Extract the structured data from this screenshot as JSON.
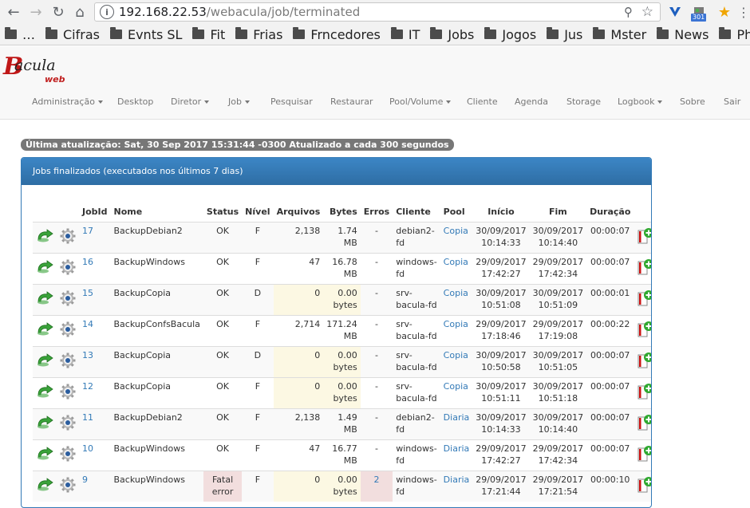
{
  "browser": {
    "url_host": "192.168.22.53",
    "url_path": "/webacula/job/terminated",
    "ext_badge": "301",
    "bookmarks": [
      "…",
      "Cifras",
      "Evnts SL",
      "Fit",
      "Frias",
      "Frncedores",
      "IT",
      "Jobs",
      "Jogos",
      "Jus",
      "Mster",
      "News",
      "PhD"
    ]
  },
  "app": {
    "logo_b": "B",
    "logo_text": "acula",
    "logo_sub": "web",
    "menu": [
      {
        "label": "Administração",
        "caret": true
      },
      {
        "label": "Desktop",
        "caret": false
      },
      {
        "label": "Diretor",
        "caret": true
      },
      {
        "label": "Job",
        "caret": true
      },
      {
        "label": "Pesquisar",
        "caret": false
      },
      {
        "label": "Restaurar",
        "caret": false
      },
      {
        "label": "Pool/Volume",
        "caret": true
      },
      {
        "label": "Cliente",
        "caret": false
      },
      {
        "label": "Agenda",
        "caret": false
      },
      {
        "label": "Storage",
        "caret": false
      },
      {
        "label": "Logbook",
        "caret": true
      },
      {
        "label": "Sobre",
        "caret": false
      },
      {
        "label": "Sair",
        "caret": false
      }
    ],
    "status_text": "Última atualização: Sat, 30 Sep 2017 15:31:44 -0300 Atualizado a cada 300 segundos",
    "panel_title": "Jobs finalizados (executados nos últimos 7 dias)"
  },
  "table": {
    "headers": [
      "",
      "",
      "JobId",
      "Nome",
      "Status",
      "Nível",
      "Arquivos",
      "Bytes",
      "Erros",
      "Cliente",
      "Pool",
      "Início",
      "Fim",
      "Duração",
      ""
    ],
    "rows": [
      {
        "jobid": "17",
        "nome": "BackupDebian2",
        "status": "OK",
        "nivel": "F",
        "arquivos": "2,138",
        "bytes": "1.74 MB",
        "erros": "-",
        "cliente": "debian2-fd",
        "pool": "Copia",
        "inicio": "30/09/2017 10:14:33",
        "fim": "30/09/2017 10:14:40",
        "duracao": "00:00:07",
        "warn": false,
        "err": false
      },
      {
        "jobid": "16",
        "nome": "BackupWindows",
        "status": "OK",
        "nivel": "F",
        "arquivos": "47",
        "bytes": "16.78 MB",
        "erros": "-",
        "cliente": "windows-fd",
        "pool": "Copia",
        "inicio": "29/09/2017 17:42:27",
        "fim": "29/09/2017 17:42:34",
        "duracao": "00:00:07",
        "warn": false,
        "err": false
      },
      {
        "jobid": "15",
        "nome": "BackupCopia",
        "status": "OK",
        "nivel": "D",
        "arquivos": "0",
        "bytes": "0.00 bytes",
        "erros": "-",
        "cliente": "srv-bacula-fd",
        "pool": "Copia",
        "inicio": "30/09/2017 10:51:08",
        "fim": "30/09/2017 10:51:09",
        "duracao": "00:00:01",
        "warn": true,
        "err": false
      },
      {
        "jobid": "14",
        "nome": "BackupConfsBacula",
        "status": "OK",
        "nivel": "F",
        "arquivos": "2,714",
        "bytes": "171.24 MB",
        "erros": "-",
        "cliente": "srv-bacula-fd",
        "pool": "Copia",
        "inicio": "29/09/2017 17:18:46",
        "fim": "29/09/2017 17:19:08",
        "duracao": "00:00:22",
        "warn": false,
        "err": false
      },
      {
        "jobid": "13",
        "nome": "BackupCopia",
        "status": "OK",
        "nivel": "D",
        "arquivos": "0",
        "bytes": "0.00 bytes",
        "erros": "-",
        "cliente": "srv-bacula-fd",
        "pool": "Copia",
        "inicio": "30/09/2017 10:50:58",
        "fim": "30/09/2017 10:51:05",
        "duracao": "00:00:07",
        "warn": true,
        "err": false
      },
      {
        "jobid": "12",
        "nome": "BackupCopia",
        "status": "OK",
        "nivel": "F",
        "arquivos": "0",
        "bytes": "0.00 bytes",
        "erros": "-",
        "cliente": "srv-bacula-fd",
        "pool": "Copia",
        "inicio": "30/09/2017 10:51:11",
        "fim": "30/09/2017 10:51:18",
        "duracao": "00:00:07",
        "warn": true,
        "err": false
      },
      {
        "jobid": "11",
        "nome": "BackupDebian2",
        "status": "OK",
        "nivel": "F",
        "arquivos": "2,138",
        "bytes": "1.49 MB",
        "erros": "-",
        "cliente": "debian2-fd",
        "pool": "Diaria",
        "inicio": "30/09/2017 10:14:33",
        "fim": "30/09/2017 10:14:40",
        "duracao": "00:00:07",
        "warn": false,
        "err": false
      },
      {
        "jobid": "10",
        "nome": "BackupWindows",
        "status": "OK",
        "nivel": "F",
        "arquivos": "47",
        "bytes": "16.77 MB",
        "erros": "-",
        "cliente": "windows-fd",
        "pool": "Diaria",
        "inicio": "29/09/2017 17:42:27",
        "fim": "29/09/2017 17:42:34",
        "duracao": "00:00:07",
        "warn": false,
        "err": false
      },
      {
        "jobid": "9",
        "nome": "BackupWindows",
        "status": "Fatal error",
        "nivel": "F",
        "arquivos": "0",
        "bytes": "0.00 bytes",
        "erros": "2",
        "cliente": "windows-fd",
        "pool": "Diaria",
        "inicio": "29/09/2017 17:21:44",
        "fim": "29/09/2017 17:21:54",
        "duracao": "00:00:10",
        "warn": true,
        "err": true
      }
    ]
  },
  "colors": {
    "accent": "#337ab7",
    "warn_bg": "#fcf8e3",
    "danger_bg": "#f2dede",
    "loop_icon": "#3aa33a",
    "log_icon_red": "#cc1111",
    "log_icon_green": "#2fa82f"
  },
  "icons": {
    "restart": "green-loop-icon",
    "gear": "gear-icon",
    "log": "log-add-icon"
  }
}
